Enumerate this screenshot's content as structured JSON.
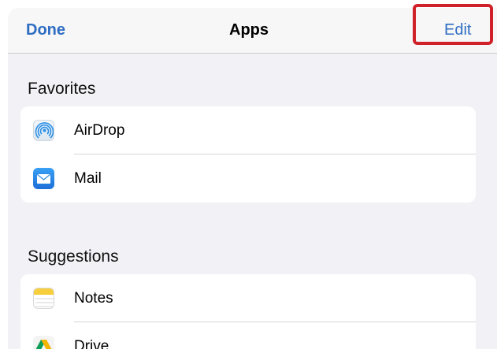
{
  "nav": {
    "done_label": "Done",
    "title": "Apps",
    "edit_label": "Edit"
  },
  "favorites": {
    "header": "Favorites",
    "items": [
      {
        "label": "AirDrop",
        "icon": "airdrop-icon"
      },
      {
        "label": "Mail",
        "icon": "mail-icon"
      }
    ]
  },
  "suggestions": {
    "header": "Suggestions",
    "items": [
      {
        "label": "Notes",
        "icon": "notes-icon"
      },
      {
        "label": "Drive",
        "icon": "drive-icon"
      }
    ]
  },
  "colors": {
    "accent": "#2f6dc2",
    "highlight": "#d0222b",
    "background": "#f2f2f6"
  }
}
